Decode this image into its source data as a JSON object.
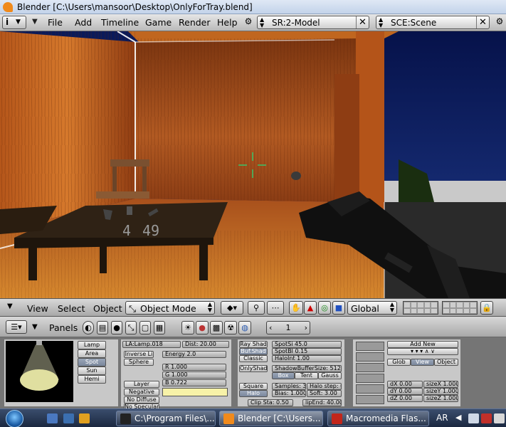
{
  "window": {
    "title": "Blender [C:\\Users\\mansoor\\Desktop\\OnlyForTray.blend]"
  },
  "menubar": {
    "info_label": "i",
    "items": [
      "File",
      "Add",
      "Timeline",
      "Game",
      "Render",
      "Help"
    ],
    "screen_selector": "SR:2-Model",
    "scene_selector": "SCE:Scene"
  },
  "hud": {
    "ammo_clip": "4",
    "ammo_total": "49"
  },
  "view3d_header": {
    "menus": [
      "View",
      "Select",
      "Object"
    ],
    "mode": "Object Mode",
    "orientation": "Global"
  },
  "buttons_header": {
    "label": "Panels",
    "frame": "1"
  },
  "lamp_panel": {
    "types": [
      "Lamp",
      "Area",
      "Spot",
      "Sun",
      "Hemi"
    ],
    "active_type": "Spot",
    "name_field": "LA:Lamp.018",
    "dist_field": "Dist: 20.00",
    "falloff_select": "Inverse Li",
    "sphere_button": "Sphere",
    "energy_field": "Energy 2.0",
    "layer_button": "Layer",
    "negative_button": "Negative",
    "nodiffuse_button": "No Diffuse",
    "nospecular_button": "No Specular",
    "r_field": "R 1.000",
    "g_field": "G 1.000",
    "b_field": "B 0.722",
    "lamp_color": "#f7f2a8"
  },
  "shadow_panel": {
    "ray_shad": "Ray Shad",
    "buf_shad": "Buf.Shad",
    "classic": "Classic",
    "onlyshad": "OnlyShad",
    "square": "Square",
    "halo": "Halo",
    "spotsi": "SpotSi 45.0",
    "spotbl": "SpotBl 0.15",
    "haloint": "HaloInt 1.00",
    "shadowbuffersize": "ShadowBufferSize: 512",
    "box": "Box",
    "tent": "Tent",
    "gauss": "Gauss",
    "samples": "Samples: 3",
    "halo_step": "Halo step: 0",
    "bias": "Bias: 1.000",
    "soft": "Soft: 3.00",
    "clip_sta": "Clip Sta: 0.50",
    "clip_end": "lipEnd: 40.00"
  },
  "texture_panel": {
    "add_new": "Add New",
    "glob": "Glob",
    "view": "View",
    "object": "Object",
    "dx": "dX 0.00",
    "dy": "dY 0.00",
    "dz": "dZ 0.00",
    "sizex": "sizeX 1.000",
    "sizey": "sizeY 1.000",
    "sizez": "sizeZ 1.000"
  },
  "taskbar": {
    "tasks": [
      {
        "label": "C:\\Program Files\\...",
        "icon_color": "#222222"
      },
      {
        "label": "Blender [C:\\Users...",
        "icon_color": "#f08a1c"
      },
      {
        "label": "Macromedia Flas...",
        "icon_color": "#c2261b"
      }
    ],
    "language": "AR"
  }
}
